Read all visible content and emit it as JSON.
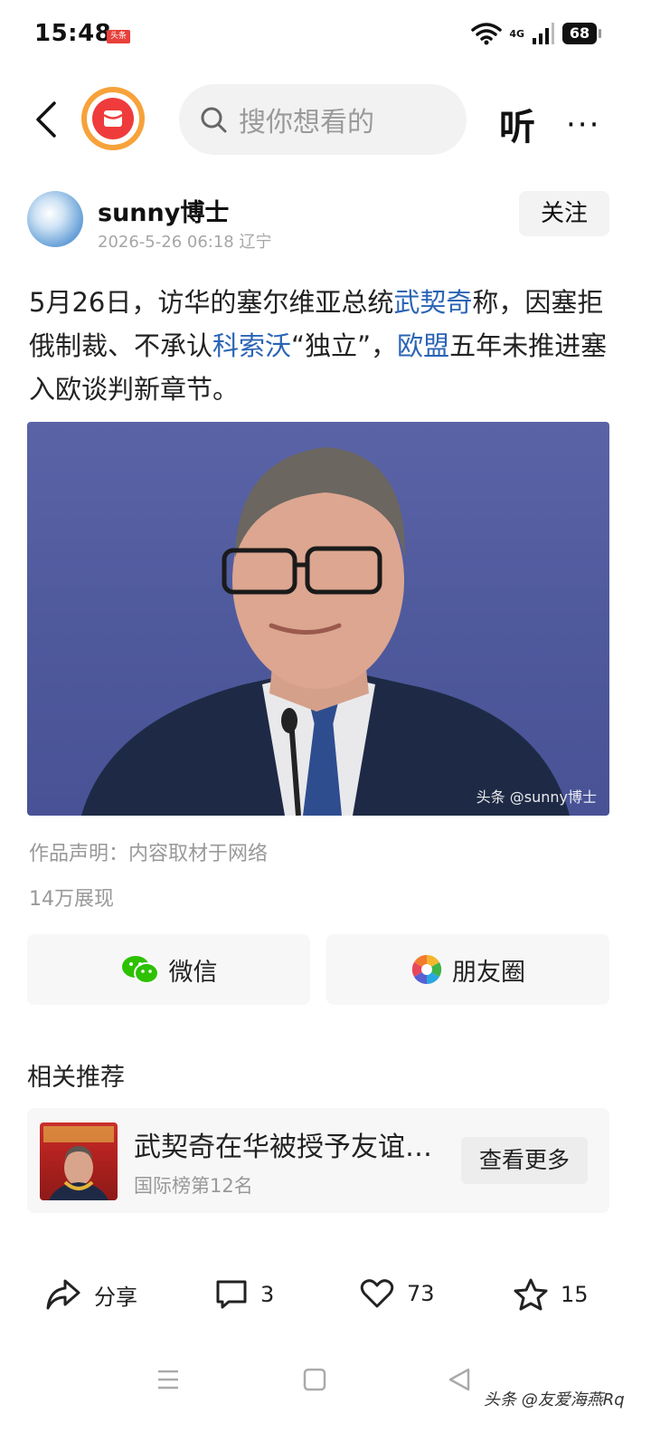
{
  "status_bar": {
    "time": "15:48",
    "app_tag": "头条",
    "network": "4G",
    "battery": "68"
  },
  "top_nav": {
    "search_placeholder": "搜你想看的",
    "listen_label": "听",
    "more_label": "···"
  },
  "author": {
    "name": "sunny博士",
    "meta": "2026-5-26 06:18 辽宁",
    "follow_label": "关注"
  },
  "article": {
    "segments": [
      {
        "text": "5月26日，访华的塞尔维亚总统",
        "link": false
      },
      {
        "text": "武契奇",
        "link": true
      },
      {
        "text": "称，因塞拒俄制裁、不承认",
        "link": false
      },
      {
        "text": "科索沃",
        "link": true
      },
      {
        "text": "“独立”，",
        "link": false
      },
      {
        "text": "欧盟",
        "link": true
      },
      {
        "text": "五年未推进塞入欧谈判新章节。",
        "link": false
      }
    ],
    "image_watermark": "头条 @sunny博士",
    "statement": "作品声明：内容取材于网络",
    "views": "14万展现"
  },
  "share": {
    "wechat_label": "微信",
    "moments_label": "朋友圈"
  },
  "related": {
    "section_title": "相关推荐",
    "title": "武契奇在华被授予友谊勋章",
    "subtitle": "国际榜第12名",
    "more_label": "查看更多"
  },
  "actions": {
    "share_label": "分享",
    "comments": "3",
    "likes": "73",
    "favorites": "15"
  },
  "footer_watermark": "头条 @友爱海燕Rq",
  "colors": {
    "link": "#2a64b5",
    "wechat_green": "#2dc100",
    "accent_orange": "#f7a23a",
    "brand_red": "#ef3b3b"
  }
}
